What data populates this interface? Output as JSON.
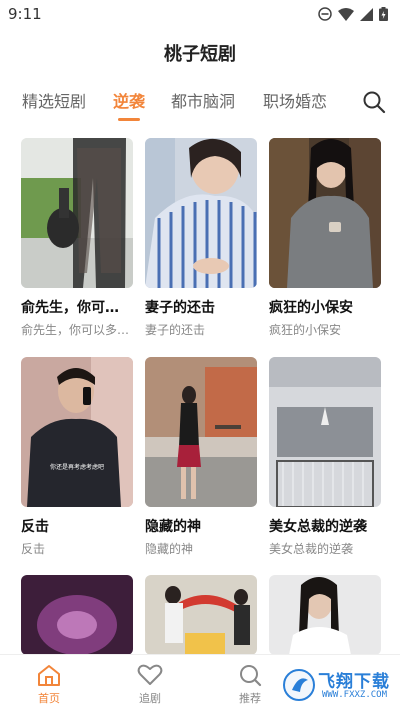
{
  "status": {
    "time": "9:11"
  },
  "header": {
    "title": "桃子短剧"
  },
  "tabs": [
    {
      "label": "精选短剧",
      "active": false
    },
    {
      "label": "逆袭",
      "active": true
    },
    {
      "label": "都市脑洞",
      "active": false
    },
    {
      "label": "职场婚恋",
      "active": false
    }
  ],
  "cards": [
    {
      "title": "俞先生，你可…",
      "subtitle": "俞先生，你可以多…"
    },
    {
      "title": "妻子的还击",
      "subtitle": "妻子的还击"
    },
    {
      "title": "疯狂的小保安",
      "subtitle": "疯狂的小保安"
    },
    {
      "title": "反击",
      "subtitle": "反击",
      "caption": "你还是再考虑考虑吧"
    },
    {
      "title": "隐藏的神",
      "subtitle": "隐藏的神"
    },
    {
      "title": "美女总裁的逆袭",
      "subtitle": "美女总裁的逆袭"
    },
    {
      "title": "",
      "subtitle": ""
    },
    {
      "title": "",
      "subtitle": ""
    },
    {
      "title": "",
      "subtitle": ""
    }
  ],
  "nav": {
    "home": "首页",
    "follow": "追剧",
    "recommend": "推荐"
  },
  "watermark": {
    "text": "飞翔下载",
    "url": "WWW.FXXZ.COM"
  },
  "colors": {
    "accent": "#f2853a",
    "watermark": "#2a7fd8"
  }
}
